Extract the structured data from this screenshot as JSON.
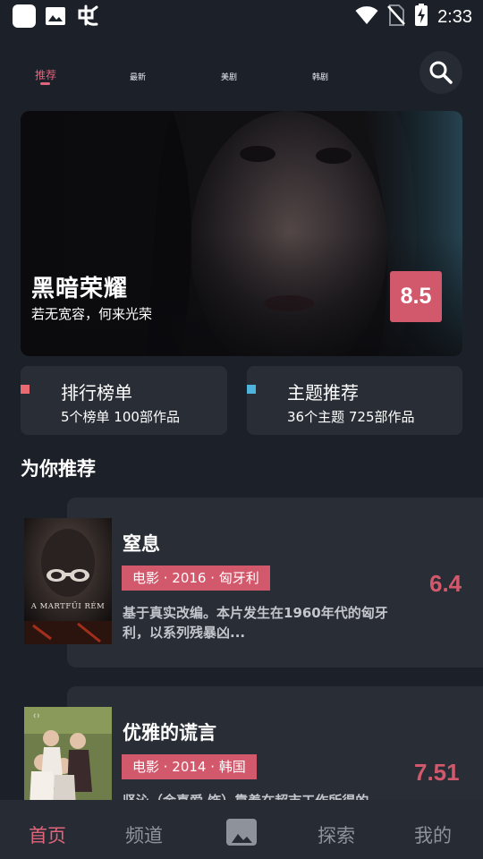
{
  "status_bar": {
    "time": "2:33",
    "left_icons": [
      "app-square-icon",
      "image-icon",
      "bug-app-icon"
    ],
    "right_icons": [
      "wifi-icon",
      "no-sim-icon",
      "battery-charging-icon"
    ]
  },
  "top_tabs": [
    {
      "label": "推荐",
      "active": true
    },
    {
      "label": "最新",
      "active": false
    },
    {
      "label": "美剧",
      "active": false
    },
    {
      "label": "韩剧",
      "active": false
    }
  ],
  "hero": {
    "title": "黑暗荣耀",
    "subtitle": "若无宽容，何来光荣",
    "score": "8.5"
  },
  "features": [
    {
      "title": "排行榜单",
      "sub": "5个榜单  100部作品",
      "color": "#e96a70"
    },
    {
      "title": "主题推荐",
      "sub": "36个主题  725部作品",
      "color": "#4fb4dc"
    }
  ],
  "section_title": "为你推荐",
  "recommendations": [
    {
      "title": "窒息",
      "tag": "电影 · 2016 · 匈牙利",
      "desc": "基于真实改编。本片发生在1960年代的匈牙利，以系列残暴凶...",
      "score": "6.4",
      "poster_text": "A MARTFŰI RÉM"
    },
    {
      "title": "优雅的谎言",
      "tag": "电影 · 2014 · 韩国",
      "desc": "坚沁（金喜爱 饰）靠着在超市工作所得的",
      "score": "7.51"
    }
  ],
  "bottom_nav": [
    {
      "label": "首页",
      "active": true
    },
    {
      "label": "频道",
      "active": false
    },
    {
      "label": "探索",
      "active": false
    },
    {
      "label": "我的",
      "active": false
    }
  ],
  "colors": {
    "background": "#1c2029",
    "card": "#282d36",
    "accent": "#d2596c",
    "accent_text": "#e0647a"
  }
}
